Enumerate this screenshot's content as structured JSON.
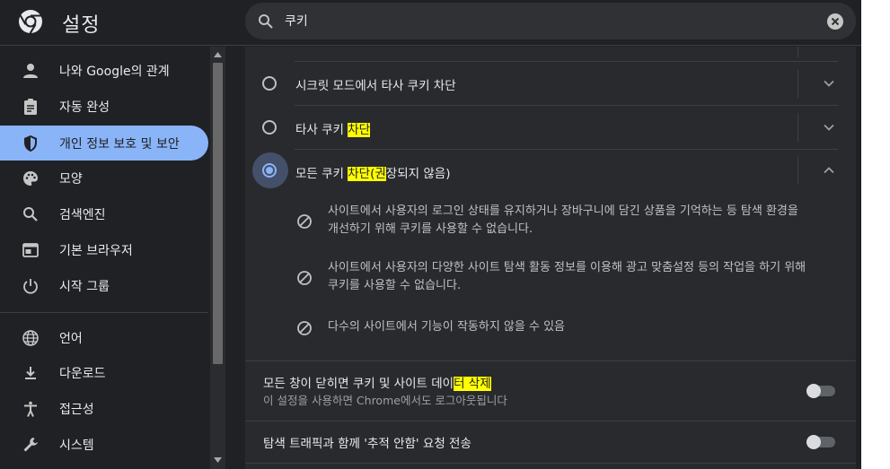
{
  "header": {
    "app_title": "설정",
    "search_value": "쿠키"
  },
  "sidebar": {
    "items": [
      {
        "label": "나와 Google의 관계",
        "icon": "person-icon"
      },
      {
        "label": "자동 완성",
        "icon": "clipboard-icon"
      },
      {
        "label": "개인 정보 보호 및 보안",
        "icon": "shield-icon"
      },
      {
        "label": "모양",
        "icon": "palette-icon"
      },
      {
        "label": "검색엔진",
        "icon": "search-icon"
      },
      {
        "label": "기본 브라우저",
        "icon": "browser-window-icon"
      },
      {
        "label": "시작 그룹",
        "icon": "power-icon"
      },
      {
        "label": "언어",
        "icon": "globe-icon"
      },
      {
        "label": "다운로드",
        "icon": "download-icon"
      },
      {
        "label": "접근성",
        "icon": "accessibility-icon"
      },
      {
        "label": "시스템",
        "icon": "wrench-icon"
      }
    ]
  },
  "cookies": {
    "options": [
      {
        "label": "시크릿 모드에서 타사 쿠키 차단"
      },
      {
        "pre": "타사 쿠키 ",
        "highlight": "차단"
      },
      {
        "pre": "모든 쿠키 ",
        "highlight": "차단(권",
        "post": "장되지 않음)"
      }
    ],
    "details": [
      {
        "line1": "사이트에서 사용자의 로그인 상태를 유지하거나 장바구니에 담긴 상품을 기억하는 등 탐색 환경을",
        "line2": "개선하기 위해 쿠키를 사용할 수 없습니다."
      },
      {
        "line1": "사이트에서 사용자의 다양한 사이트 탐색 활동 정보를 이용해 광고 맞춤설정 등의 작업을 하기 위해",
        "line2": "쿠키를 사용할 수 없습니다."
      },
      {
        "line1": "다수의 사이트에서 기능이 작동하지 않을 수 있음"
      }
    ]
  },
  "clear_on_exit": {
    "title_pre": "모든 창이 닫히면 쿠키 및 사이트 데이",
    "title_highlight": "터 삭제",
    "subtitle": "이 설정을 사용하면 Chrome에서도 로그아웃됩니다"
  },
  "do_not_track": {
    "title": "탐색 트래픽과 함께 '추적 안함' 요청 전송"
  },
  "colors": {
    "background": "#202124",
    "card": "#292a2d",
    "accent": "#8ab4f8",
    "highlight": "#ffff00"
  }
}
